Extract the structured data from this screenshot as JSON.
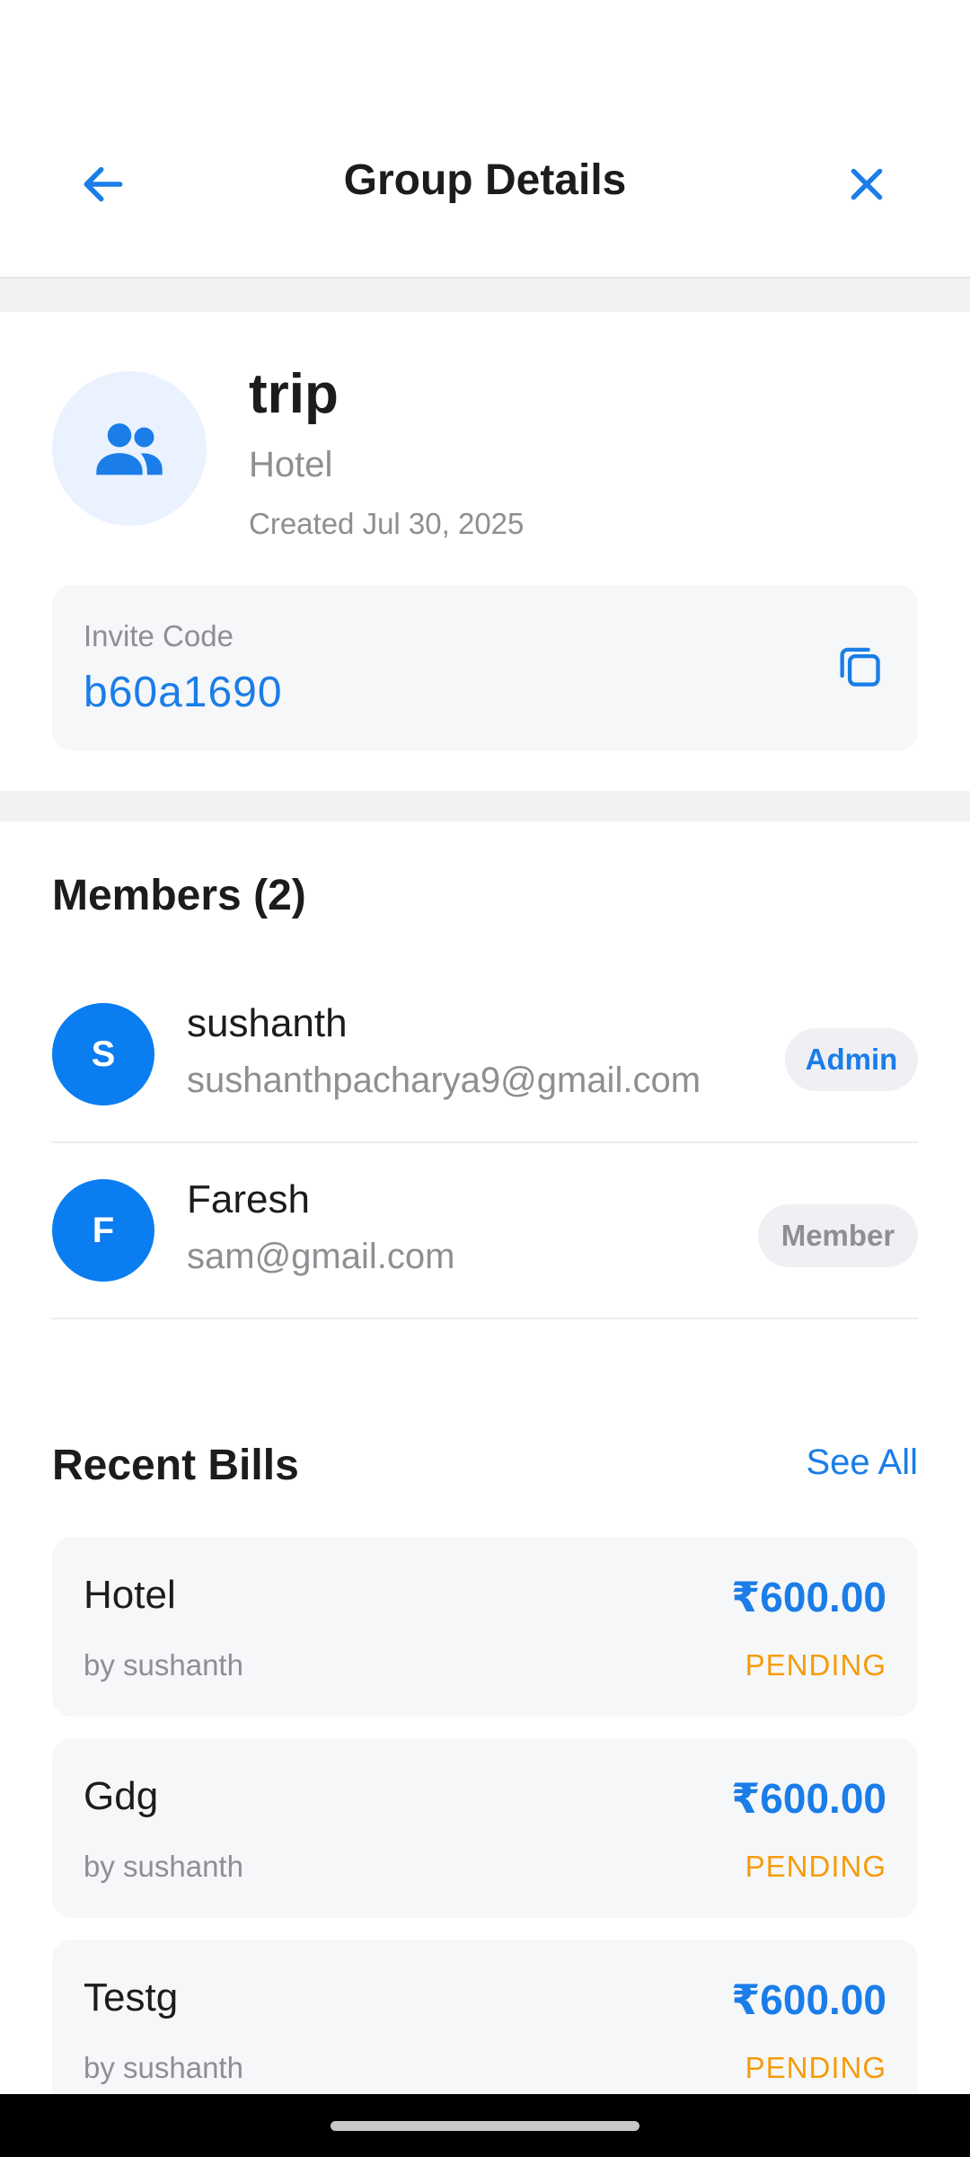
{
  "header": {
    "title": "Group Details",
    "back_icon": "arrow-left-icon",
    "close_icon": "close-icon"
  },
  "group": {
    "icon": "group-people-icon",
    "name": "trip",
    "category": "Hotel",
    "created": "Created Jul 30, 2025",
    "invite_label": "Invite Code",
    "invite_code": "b60a1690",
    "copy_icon": "copy-icon"
  },
  "members": {
    "title": "Members (2)",
    "items": [
      {
        "initial": "S",
        "name": "sushanth",
        "email": "sushanthpacharya9@gmail.com",
        "role": "Admin"
      },
      {
        "initial": "F",
        "name": "Faresh",
        "email": "sam@gmail.com",
        "role": "Member"
      }
    ]
  },
  "bills": {
    "title": "Recent Bills",
    "see_all": "See All",
    "items": [
      {
        "title": "Hotel",
        "by": "by sushanth",
        "amount": "₹600.00",
        "status": "PENDING"
      },
      {
        "title": "Gdg",
        "by": "by sushanth",
        "amount": "₹600.00",
        "status": "PENDING"
      },
      {
        "title": "Testg",
        "by": "by sushanth",
        "amount": "₹600.00",
        "status": "PENDING"
      }
    ]
  },
  "colors": {
    "accent": "#1a7de8",
    "avatar": "#0a7df0",
    "pending": "#f59c0b",
    "muted": "#8e8e93"
  }
}
